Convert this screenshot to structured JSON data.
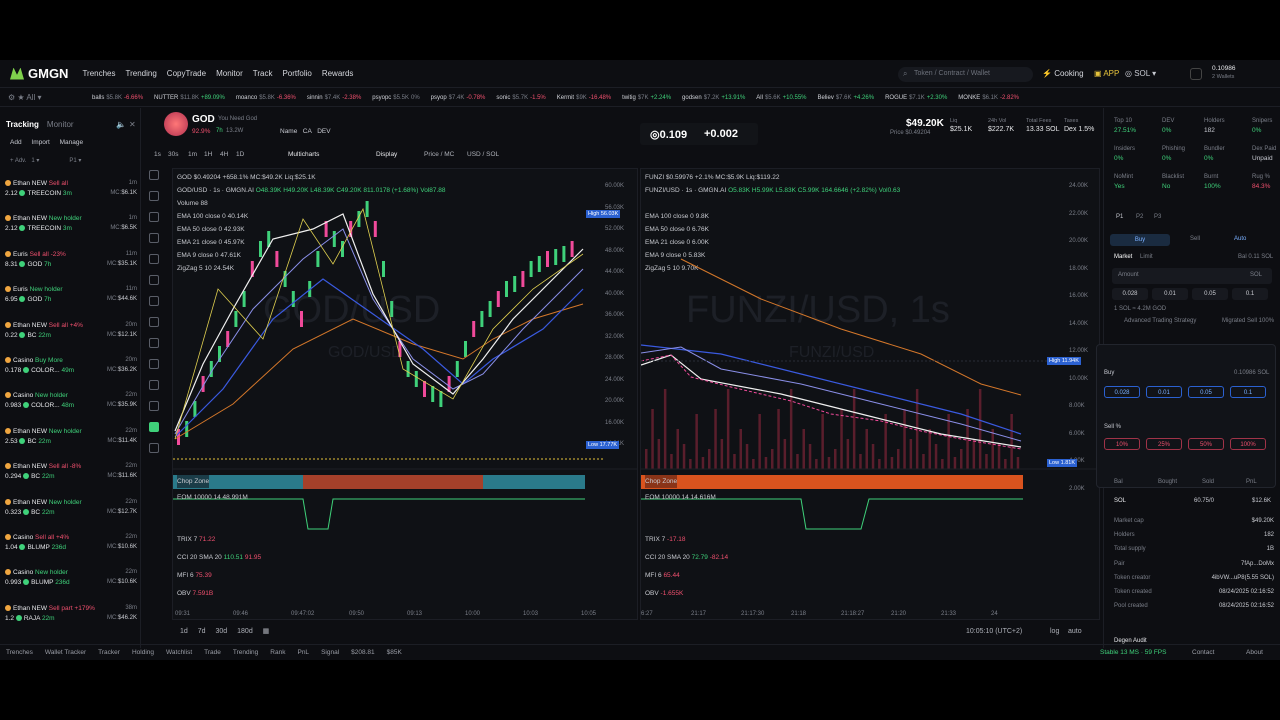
{
  "nav": {
    "brand": "GMGN",
    "links": [
      "Trenches",
      "Trending",
      "CopyTrade",
      "Monitor",
      "Track",
      "Portfolio",
      "Rewards"
    ],
    "search_placeholder": "Token / Contract / Wallet",
    "cooking": "Cooking",
    "app": "APP",
    "chain": "SOL",
    "wallet_balance": "0.10986",
    "wallets": "2 Wallets"
  },
  "ticker": [
    {
      "name": "balls",
      "price": "$5.8K",
      "chg": "-6.66%",
      "dir": "dn"
    },
    {
      "name": "NUTTER",
      "price": "$11.8K",
      "chg": "+89.09%",
      "dir": "up"
    },
    {
      "name": "moanco",
      "price": "$5.8K",
      "chg": "-6.36%",
      "dir": "dn"
    },
    {
      "name": "sinnin",
      "price": "$7.4K",
      "chg": "-2.38%",
      "dir": "dn"
    },
    {
      "name": "psyopc",
      "price": "$5.5K",
      "chg": "0%",
      "dir": "p"
    },
    {
      "name": "psyop",
      "price": "$7.4K",
      "chg": "-0.78%",
      "dir": "dn"
    },
    {
      "name": "sonic",
      "price": "$5.7K",
      "chg": "-1.5%",
      "dir": "dn"
    },
    {
      "name": "Kermit",
      "price": "$9K",
      "chg": "-16.48%",
      "dir": "dn"
    },
    {
      "name": "twitig",
      "price": "$7K",
      "chg": "+2.24%",
      "dir": "up"
    },
    {
      "name": "godsen",
      "price": "$7.2K",
      "chg": "+13.91%",
      "dir": "up"
    },
    {
      "name": "All",
      "price": "$5.6K",
      "chg": "+10.55%",
      "dir": "up"
    },
    {
      "name": "Believ",
      "price": "$7.6K",
      "chg": "+4.26%",
      "dir": "up"
    },
    {
      "name": "ROGUE",
      "price": "$7.1K",
      "chg": "+2.30%",
      "dir": "up"
    },
    {
      "name": "MONKE",
      "price": "$6.1K",
      "chg": "-2.82%",
      "dir": "dn"
    }
  ],
  "tracker": {
    "tab_tracking": "Tracking",
    "tab_monitor": "Monitor",
    "add": "Add",
    "import": "Import",
    "manage": "Manage",
    "rows": [
      {
        "who": "Ethan NEW",
        "action": "Sell all",
        "act_cls": "red",
        "time": "1m",
        "amt": "2.12",
        "token": "TREECOIN",
        "age": "3m",
        "mc": "$6.1K"
      },
      {
        "who": "Ethan NEW",
        "action": "New holder",
        "act_cls": "green",
        "time": "1m",
        "amt": "2.12",
        "token": "TREECOIN",
        "age": "3m",
        "mc": "$6.5K"
      },
      {
        "who": "Euris",
        "action": "Sell all -23%",
        "act_cls": "red",
        "time": "11m",
        "amt": "8.31",
        "token": "GOD",
        "age": "7h",
        "mc": "$35.1K"
      },
      {
        "who": "Euris",
        "action": "New holder",
        "act_cls": "green",
        "time": "11m",
        "amt": "6.95",
        "token": "GOD",
        "age": "7h",
        "mc": "$44.6K"
      },
      {
        "who": "Ethan NEW",
        "action": "Sell all +4%",
        "act_cls": "red",
        "time": "20m",
        "amt": "0.22",
        "token": "BC",
        "age": "22m",
        "mc": "$12.1K"
      },
      {
        "who": "Casino",
        "action": "Buy More",
        "act_cls": "green",
        "time": "20m",
        "amt": "0.178",
        "token": "COLOR...",
        "age": "49m",
        "mc": "$36.2K"
      },
      {
        "who": "Casino",
        "action": "New holder",
        "act_cls": "green",
        "time": "22m",
        "amt": "0.983",
        "token": "COLOR...",
        "age": "48m",
        "mc": "$35.9K"
      },
      {
        "who": "Ethan NEW",
        "action": "New holder",
        "act_cls": "green",
        "time": "22m",
        "amt": "2.53",
        "token": "BC",
        "age": "22m",
        "mc": "$11.4K"
      },
      {
        "who": "Ethan NEW",
        "action": "Sell all -8%",
        "act_cls": "red",
        "time": "22m",
        "amt": "0.294",
        "token": "BC",
        "age": "22m",
        "mc": "$11.6K"
      },
      {
        "who": "Ethan NEW",
        "action": "New holder",
        "act_cls": "green",
        "time": "22m",
        "amt": "0.323",
        "token": "BC",
        "age": "22m",
        "mc": "$12.7K"
      },
      {
        "who": "Casino",
        "action": "Sell all +4%",
        "act_cls": "red",
        "time": "22m",
        "amt": "1.04",
        "token": "BLUMP",
        "age": "236d",
        "mc": "$10.6K"
      },
      {
        "who": "Casino",
        "action": "New holder",
        "act_cls": "green",
        "time": "22m",
        "amt": "0.993",
        "token": "BLUMP",
        "age": "236d",
        "mc": "$10.6K"
      },
      {
        "who": "Ethan NEW",
        "action": "Sell part +179%",
        "act_cls": "red",
        "time": "38m",
        "amt": "1.2",
        "token": "RAJA",
        "age": "22m",
        "mc": "$46.2K"
      }
    ]
  },
  "token": {
    "symbol": "GOD",
    "subtitle": "You Need God",
    "change": "92.9%",
    "age": "7h",
    "holders_short": "13.2W",
    "actions": [
      "Name",
      "CA",
      "DEV"
    ],
    "price_big": "$49.20K",
    "price_small": "Price $0.49204",
    "stats": [
      {
        "label": "Liq",
        "value": "$25.1K"
      },
      {
        "label": "24h Vol",
        "value": "$222.7K"
      },
      {
        "label": "Total Fees",
        "value": "13.33 SOL"
      },
      {
        "label": "Taxes",
        "value": "Dex 1.5%"
      }
    ]
  },
  "toolbar": {
    "intervals": [
      "1s",
      "30s",
      "1m",
      "1H",
      "4H",
      "1D"
    ],
    "multicharts": "Multicharts",
    "display": "Display",
    "price_mc": "Price / MC",
    "usd_sol": "USD / SOL"
  },
  "chart1": {
    "title": "GOD/USD · 1s · GMGN.AI",
    "header": "GOD $0.49204 +658.1% MC:$49.2K Liq:$25.1K",
    "ohlc": "O48.39K H49.20K L48.39K C49.20K 811.0178 (+1.68%) Vol87.88",
    "watermark": "GOD/USD",
    "watermark_sub": "GOD/USD",
    "legend": [
      "Volume 88",
      "EMA 100 close 0 40.14K",
      "EMA 50 close 0 42.93K",
      "EMA 21 close 0 45.97K",
      "EMA 9 close 0 47.61K",
      "ZigZag 5 10 24.54K"
    ],
    "yticks": [
      "60.00K",
      "56.03K",
      "52.00K",
      "48.00K",
      "44.00K",
      "40.00K",
      "36.00K",
      "32.00K",
      "28.00K",
      "24.00K",
      "20.00K",
      "16.00K",
      "14.91K"
    ],
    "high_label": "High",
    "low_label": "Low",
    "low_value": "17.77K",
    "xticks": [
      "09:31",
      "09:46",
      "09:47:02",
      "09:50",
      "09:13",
      "10:00",
      "10:03",
      "10:05"
    ],
    "chop": "Chop Zone",
    "eom": "EOM 10000 14 48.991M",
    "trix": "TRIX 7",
    "trix_val": "71.22",
    "cci": "CCI 20 SMA 20",
    "cci_val": "110.51",
    "cci_val2": "91.95",
    "mfi": "MFI 6",
    "mfi_val": "75.39",
    "obv": "OBV",
    "obv_val": "7.591B"
  },
  "chart2": {
    "header": "FUNZI $0.59976 +2.1% MC:$5.9K Liq:$119.22",
    "title": "FUNZI/USD · 1s · GMGN.AI",
    "ohlc": "O5.83K H5.99K L5.83K C5.99K 164.6646 (+2.82%) Vol0.63",
    "watermark": "FUNZI/USD, 1s",
    "watermark_sub": "FUNZI/USD",
    "legend": [
      "EMA 100 close 0 9.8K",
      "EMA 50 close 0 6.76K",
      "EMA 21 close 0 6.00K",
      "EMA 9 close 0 5.83K",
      "ZigZag 5 10 9.70K"
    ],
    "yticks": [
      "24.00K",
      "22.00K",
      "20.00K",
      "18.00K",
      "16.00K",
      "14.00K",
      "12.00K",
      "10.00K",
      "8.00K",
      "6.00K",
      "4.00K",
      "2.00K"
    ],
    "high_label": "High",
    "high_value": "11.94K",
    "low_label": "Low",
    "low_value": "1.81K",
    "xticks": [
      "6:27",
      "21:17",
      "21:17:30",
      "21:18",
      "21:18:27",
      "21:20",
      "21:33",
      "24"
    ],
    "chop": "Chop Zone",
    "eom": "EOM 10000 14 14.616M",
    "trix": "TRIX 7",
    "trix_val": "-17.18",
    "cci": "CCI 20 SMA 20",
    "cci_val": "72.79",
    "cci_val2": "-82.14",
    "mfi": "MFI 6",
    "mfi_val": "65.44",
    "obv": "OBV",
    "obv_val": "-1.655K"
  },
  "ranges": {
    "items": [
      "1d",
      "7d",
      "30d",
      "180d"
    ],
    "clock": "10:05:10 (UTC+2)",
    "log": "log",
    "auto": "auto"
  },
  "trade_panel": {
    "top10_label": "Top 10",
    "top10": "27.51%",
    "dev_label": "DEV",
    "dev": "0%",
    "holders_label": "Holders",
    "holders": "182",
    "snipers_label": "Snipers",
    "snipers": "0%",
    "insiders_label": "Insiders",
    "insiders": "0%",
    "phishing_label": "Phishing",
    "phishing": "0%",
    "bundler_label": "Bundler",
    "bundler": "0%",
    "dexpaid_label": "Dex Paid",
    "dexpaid": "Unpaid",
    "nomint_label": "NoMint",
    "nomint": "Yes",
    "blacklist_label": "Blacklist",
    "blacklist": "No",
    "burnt_label": "Burnt",
    "burnt": "100%",
    "rug_label": "Rug %",
    "rug": "84.3%",
    "presets": [
      "P1",
      "P2",
      "P3"
    ],
    "buy": "Buy",
    "sell": "Sell",
    "auto": "Auto",
    "market": "Market",
    "limit": "Limit",
    "balance": "Bal 0.11 SOL",
    "amount": "Amount",
    "amount_unit": "SOL",
    "quick": [
      "0.028",
      "0.01",
      "0.05",
      "0.1"
    ],
    "quote": "1 SOL ≈ 4.2M GOD",
    "adv": "Advanced Trading Strategy",
    "migrated": "Migrated Sell 100%",
    "mini_buy": "Buy",
    "mini_buy_bal": "0.10986 SOL",
    "mini_quick": [
      "0.028",
      "0.01",
      "0.05",
      "0.1"
    ],
    "mini_sell": "Sell %",
    "mini_pct": [
      "10%",
      "25%",
      "50%",
      "100%"
    ],
    "pos_cols": [
      "Bal",
      "Bought",
      "Sold",
      "PnL"
    ],
    "sol_label": "SOL",
    "sol_pair": "60.75/0",
    "sol_val": "$12.6K",
    "info": [
      {
        "k": "Market cap",
        "v": "$49.20K"
      },
      {
        "k": "Holders",
        "v": "182"
      },
      {
        "k": "Total supply",
        "v": "1B"
      },
      {
        "k": "Pair",
        "v": "7fAp...DoMx"
      },
      {
        "k": "Token creator",
        "v": "4ibVW...uP8(5.55 SOL)"
      },
      {
        "k": "Token created",
        "v": "08/24/2025 02:16:52"
      },
      {
        "k": "Pool created",
        "v": "08/24/2025 02:16:52"
      }
    ],
    "dev_audit": "Degen Audit"
  },
  "bottom": {
    "items": [
      "Trenches",
      "Wallet Tracker",
      "Tracker",
      "Holding",
      "Watchlist",
      "Trade",
      "Trending",
      "Rank",
      "PnL",
      "Signal",
      "$208.81",
      "$85K"
    ],
    "status": "Stable 13 MS · 59 FPS",
    "contact": "Contact",
    "about": "About"
  }
}
